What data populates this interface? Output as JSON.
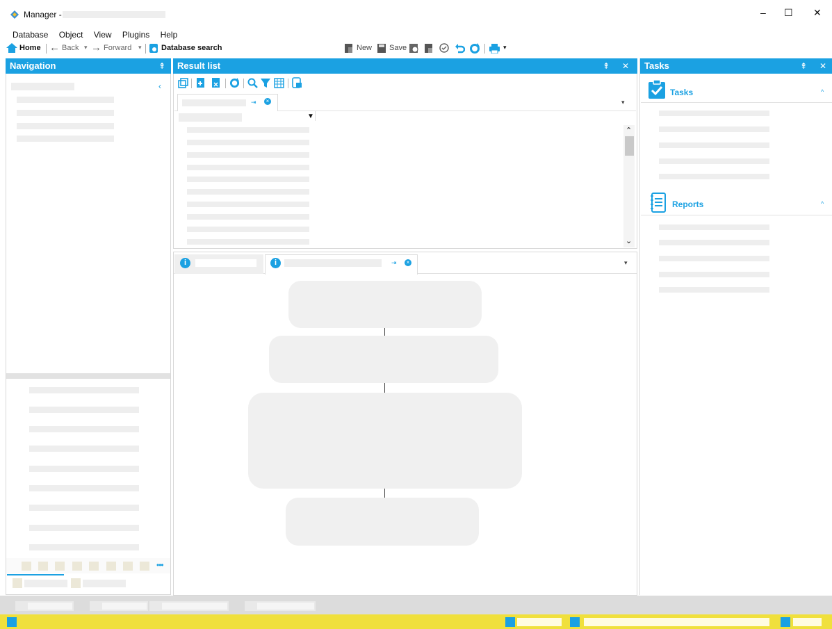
{
  "window": {
    "title": "Manager -",
    "minimize_label": "–",
    "maximize_label": "☐",
    "close_label": "✕"
  },
  "menu": [
    "Database",
    "Object",
    "View",
    "Plugins",
    "Help"
  ],
  "navbar": {
    "home": "Home",
    "back": "Back",
    "forward": "Forward",
    "db_search": "Database search"
  },
  "toolbar": {
    "new": "New",
    "save": "Save"
  },
  "panels": {
    "navigation": "Navigation",
    "result_list": "Result list",
    "tasks": "Tasks",
    "pin": "⇞",
    "close": "✕",
    "collapse": "‹"
  },
  "tasks_panel": {
    "tasks_section": "Tasks",
    "reports_section": "Reports",
    "caret": "^"
  },
  "colors": {
    "accent": "#1ba1e2",
    "status_bar": "#f0e03c",
    "placeholder": "#eeeeee"
  }
}
